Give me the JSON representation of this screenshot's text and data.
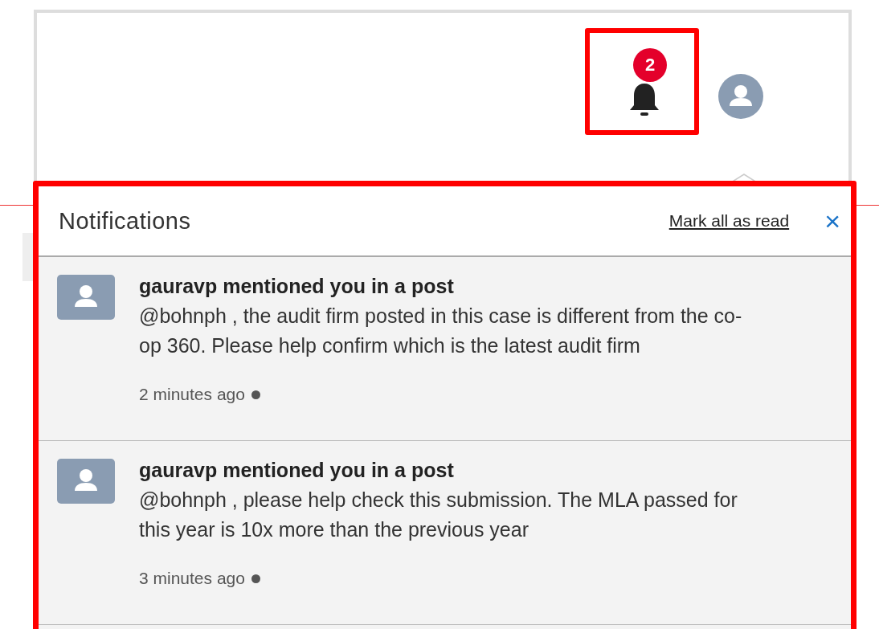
{
  "header": {
    "notification_count": "2"
  },
  "notifications_panel": {
    "title": "Notifications",
    "mark_all_link": "Mark all as read",
    "close_icon": "×",
    "items": [
      {
        "title": "gauravp mentioned you in a post",
        "message": "@bohnph , the audit firm posted in this case is different from the co-op 360. Please help confirm which is the latest audit firm",
        "time": "2 minutes ago",
        "unread": true
      },
      {
        "title": "gauravp mentioned you in a post",
        "message": "@bohnph , please help check this submission. The MLA passed for this year is 10x more than the previous year",
        "time": "3 minutes ago",
        "unread": true
      }
    ]
  }
}
